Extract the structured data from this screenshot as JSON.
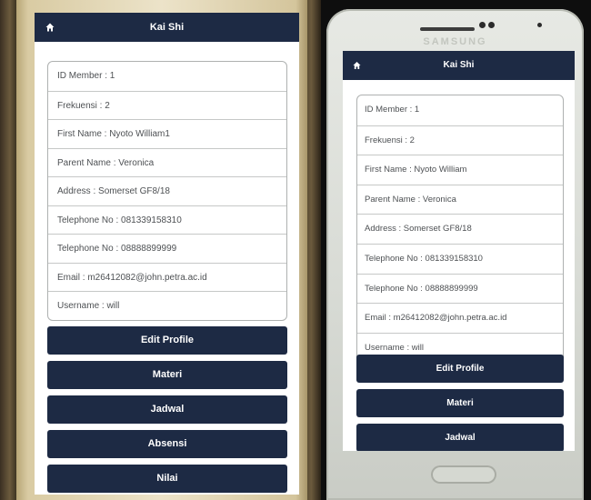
{
  "app": {
    "title": "Kai Shi",
    "brand": "SAMSUNG"
  },
  "left_screen": {
    "info": [
      "ID Member : 1",
      "Frekuensi : 2",
      "First Name : Nyoto William1",
      "Parent Name : Veronica",
      "Address : Somerset GF8/18",
      "Telephone No : 081339158310",
      "Telephone No : 08888899999",
      "Email : m26412082@john.petra.ac.id",
      "Username : will"
    ],
    "buttons": [
      "Edit Profile",
      "Materi",
      "Jadwal",
      "Absensi",
      "Nilai"
    ]
  },
  "right_screen": {
    "info": [
      "ID Member : 1",
      "Frekuensi : 2",
      "First Name : Nyoto William",
      "Parent Name : Veronica",
      "Address : Somerset GF8/18",
      "Telephone No : 081339158310",
      "Telephone No : 08888899999",
      "Email : m26412082@john.petra.ac.id",
      "Username : will"
    ],
    "buttons": [
      "Edit Profile",
      "Materi",
      "Jadwal"
    ]
  },
  "colors": {
    "header": "#1d2a44",
    "button": "#1d2a44",
    "text": "#4e5154"
  },
  "icons": {
    "home": "home-icon"
  }
}
